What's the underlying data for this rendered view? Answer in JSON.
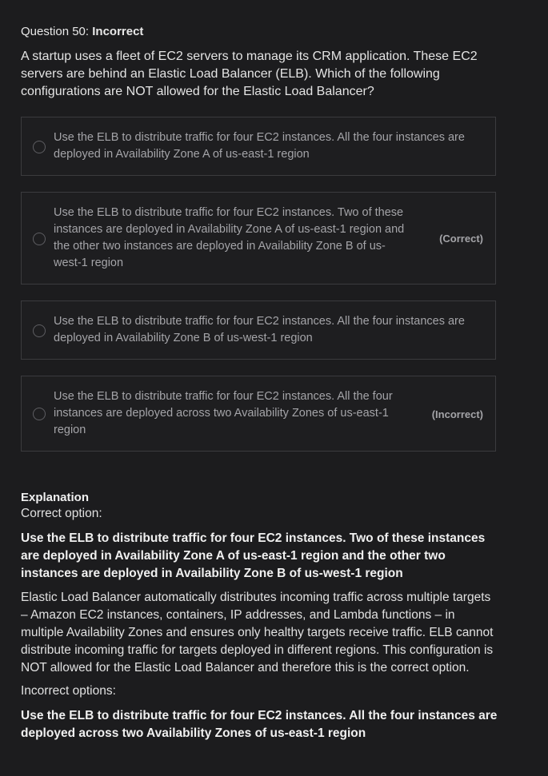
{
  "question": {
    "label": "Question 50: ",
    "status": "Incorrect",
    "text": "A startup uses a fleet of EC2 servers to manage its CRM application. These EC2 servers are behind an Elastic Load Balancer (ELB). Which of the following configurations are NOT allowed for the Elastic Load Balancer?"
  },
  "options": [
    {
      "text": "Use the ELB to distribute traffic for four EC2 instances. All the four instances are deployed in Availability Zone A of us-east-1 region",
      "badge": ""
    },
    {
      "text": "Use the ELB to distribute traffic for four EC2 instances. Two of these instances are deployed in Availability Zone A of us-east-1 region and the other two instances are deployed in Availability Zone B of us-west-1 region",
      "badge": "(Correct)"
    },
    {
      "text": "Use the ELB to distribute traffic for four EC2 instances. All the four instances are deployed in Availability Zone B of us-west-1 region",
      "badge": ""
    },
    {
      "text": "Use the ELB to distribute traffic for four EC2 instances. All the four instances are deployed across two Availability Zones of us-east-1 region",
      "badge": "(Incorrect)"
    }
  ],
  "explanation": {
    "title": "Explanation",
    "correct_label": "Correct option:",
    "correct_option": "Use the ELB to distribute traffic for four EC2 instances. Two of these instances are deployed in Availability Zone A of us-east-1 region and the other two instances are deployed in Availability Zone B of us-west-1 region",
    "body": "Elastic Load Balancer automatically distributes incoming traffic across multiple targets – Amazon EC2 instances, containers, IP addresses, and Lambda functions – in multiple Availability Zones and ensures only healthy targets receive traffic. ELB cannot distribute incoming traffic for targets deployed in different regions. This configuration is NOT allowed for the Elastic Load Balancer and therefore this is the correct option.",
    "incorrect_label": "Incorrect options:",
    "incorrect_option": "Use the ELB to distribute traffic for four EC2 instances. All the four instances are deployed across two Availability Zones of us-east-1 region"
  }
}
